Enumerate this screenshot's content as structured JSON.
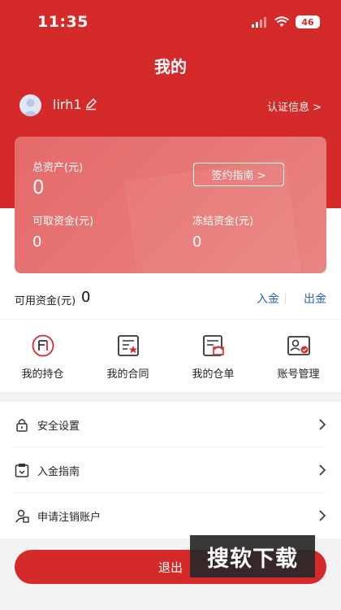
{
  "status_bar": {
    "time": "11:35",
    "battery": "46"
  },
  "header": {
    "title": "我的"
  },
  "profile": {
    "username": "lirh1",
    "cert_link": "认证信息 >"
  },
  "asset_card": {
    "total_label": "总资产(元)",
    "total_value": "0",
    "guide_button": "签约指南 >",
    "cash_label": "可取资金(元)",
    "cash_value": "0",
    "frozen_label": "冻结资金(元)",
    "frozen_value": "0"
  },
  "available": {
    "label": "可用资金(元)",
    "value": "0",
    "deposit": "入金",
    "withdraw": "出金"
  },
  "grid": [
    {
      "label": "我的持仓",
      "icon": "position-icon"
    },
    {
      "label": "我的合同",
      "icon": "contract-icon"
    },
    {
      "label": "我的仓单",
      "icon": "warehouse-receipt-icon"
    },
    {
      "label": "账号管理",
      "icon": "account-card-icon"
    }
  ],
  "menu": [
    {
      "label": "安全设置",
      "icon": "lock-icon"
    },
    {
      "label": "入金指南",
      "icon": "deposit-guide-icon"
    },
    {
      "label": "申请注销账户",
      "icon": "cancel-account-icon"
    }
  ],
  "logout": {
    "label": "退出"
  },
  "watermark": {
    "text": "搜软下载"
  },
  "colors": {
    "brand_red": "#d42a2a",
    "link_blue": "#2a63b8"
  }
}
